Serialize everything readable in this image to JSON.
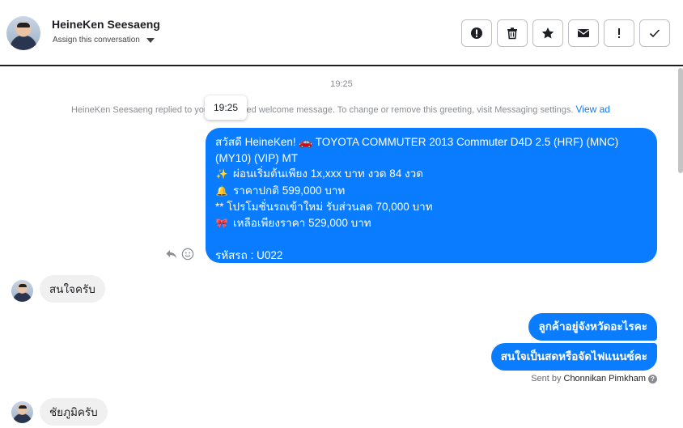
{
  "header": {
    "contact_name": "HeineKen Seesaeng",
    "assign_label": "Assign this conversation",
    "actions": [
      {
        "name": "report-button",
        "icon": "alert-circle-icon"
      },
      {
        "name": "delete-button",
        "icon": "trash-icon"
      },
      {
        "name": "star-button",
        "icon": "star-icon"
      },
      {
        "name": "mark-unread-button",
        "icon": "mail-icon"
      },
      {
        "name": "spam-button",
        "icon": "exclamation-icon"
      },
      {
        "name": "done-button",
        "icon": "check-icon"
      }
    ]
  },
  "conversation": {
    "timestamp": "19:25",
    "tooltip_time": "19:25",
    "system_message": "HeineKen Seesaeng replied to your automated welcome message. To change or remove this greeting, visit Messaging settings.",
    "system_link": "View ad",
    "welcome_lines": [
      {
        "emoji": "",
        "text": "สวัสดี HeineKen! 🚗  TOYOTA COMMUTER 2013 Commuter D4D 2.5 (HRF) (MNC)"
      },
      {
        "emoji": "",
        "text": "(MY10) (VIP) MT"
      },
      {
        "emoji": "✨",
        "text": "ผ่อนเริ่มต้นเพียง 1x,xxx บาท งวด 84 งวด"
      },
      {
        "emoji": "🔔",
        "text": "ราคาปกติ 599,000 บาท"
      },
      {
        "emoji": "",
        "text": "** โปรโมชั่นรถเข้าใหม่ รับส่วนลด 70,000 บาท"
      },
      {
        "emoji": "🎀",
        "text": "เหลือเพียงราคา 529,000 บาท"
      },
      {
        "emoji": "",
        "text": ""
      },
      {
        "emoji": "",
        "text": "รหัสรถ : U022"
      }
    ],
    "incoming_1": "สนใจครับ",
    "outgoing_1": "ลูกค้าอยู่จังหวัดอะไรคะ",
    "outgoing_2": "สนใจเป็นสดหรือจัดไฟแนนซ์คะ",
    "sent_by_label": "Sent by",
    "sent_by_name": "Chonnikan Pimkham",
    "incoming_2": "ชัยภูมิครับ"
  },
  "colors": {
    "accent": "#0a7cff",
    "incoming_bg": "#f0f0f0",
    "muted_text": "#8a8d91",
    "link": "#1877f2"
  }
}
